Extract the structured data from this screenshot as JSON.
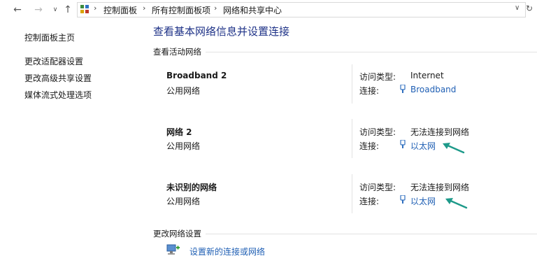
{
  "address_bar": {
    "back": "←",
    "forward": "→",
    "history": "∨",
    "up": "↑",
    "breadcrumbs": [
      "控制面板",
      "所有控制面板项",
      "网络和共享中心"
    ],
    "separator": "›",
    "dropdown": "∨",
    "refresh": "↻"
  },
  "sidebar": {
    "items": [
      {
        "label": "控制面板主页"
      },
      {
        "label": "更改适配器设置"
      },
      {
        "label": "更改高级共享设置"
      },
      {
        "label": "媒体流式处理选项"
      }
    ]
  },
  "main": {
    "title": "查看基本网络信息并设置连接",
    "active_section": "查看活动网络",
    "networks": [
      {
        "name": "Broadband 2",
        "type": "公用网络",
        "access_label": "访问类型:",
        "access_value": "Internet",
        "conn_label": "连接:",
        "conn_value": "Broadband",
        "arrow": false
      },
      {
        "name": "网络 2",
        "type": "公用网络",
        "access_label": "访问类型:",
        "access_value": "无法连接到网络",
        "conn_label": "连接:",
        "conn_value": "以太网",
        "arrow": true
      },
      {
        "name": "未识别的网络",
        "type": "公用网络",
        "access_label": "访问类型:",
        "access_value": "无法连接到网络",
        "conn_label": "连接:",
        "conn_value": "以太网",
        "arrow": true
      }
    ],
    "change_section": "更改网络设置",
    "setup_link": "设置新的连接或网络"
  },
  "colors": {
    "title": "#1e3287",
    "link": "#1f5fb4",
    "annotation_arrow": "#1e9a8a"
  }
}
